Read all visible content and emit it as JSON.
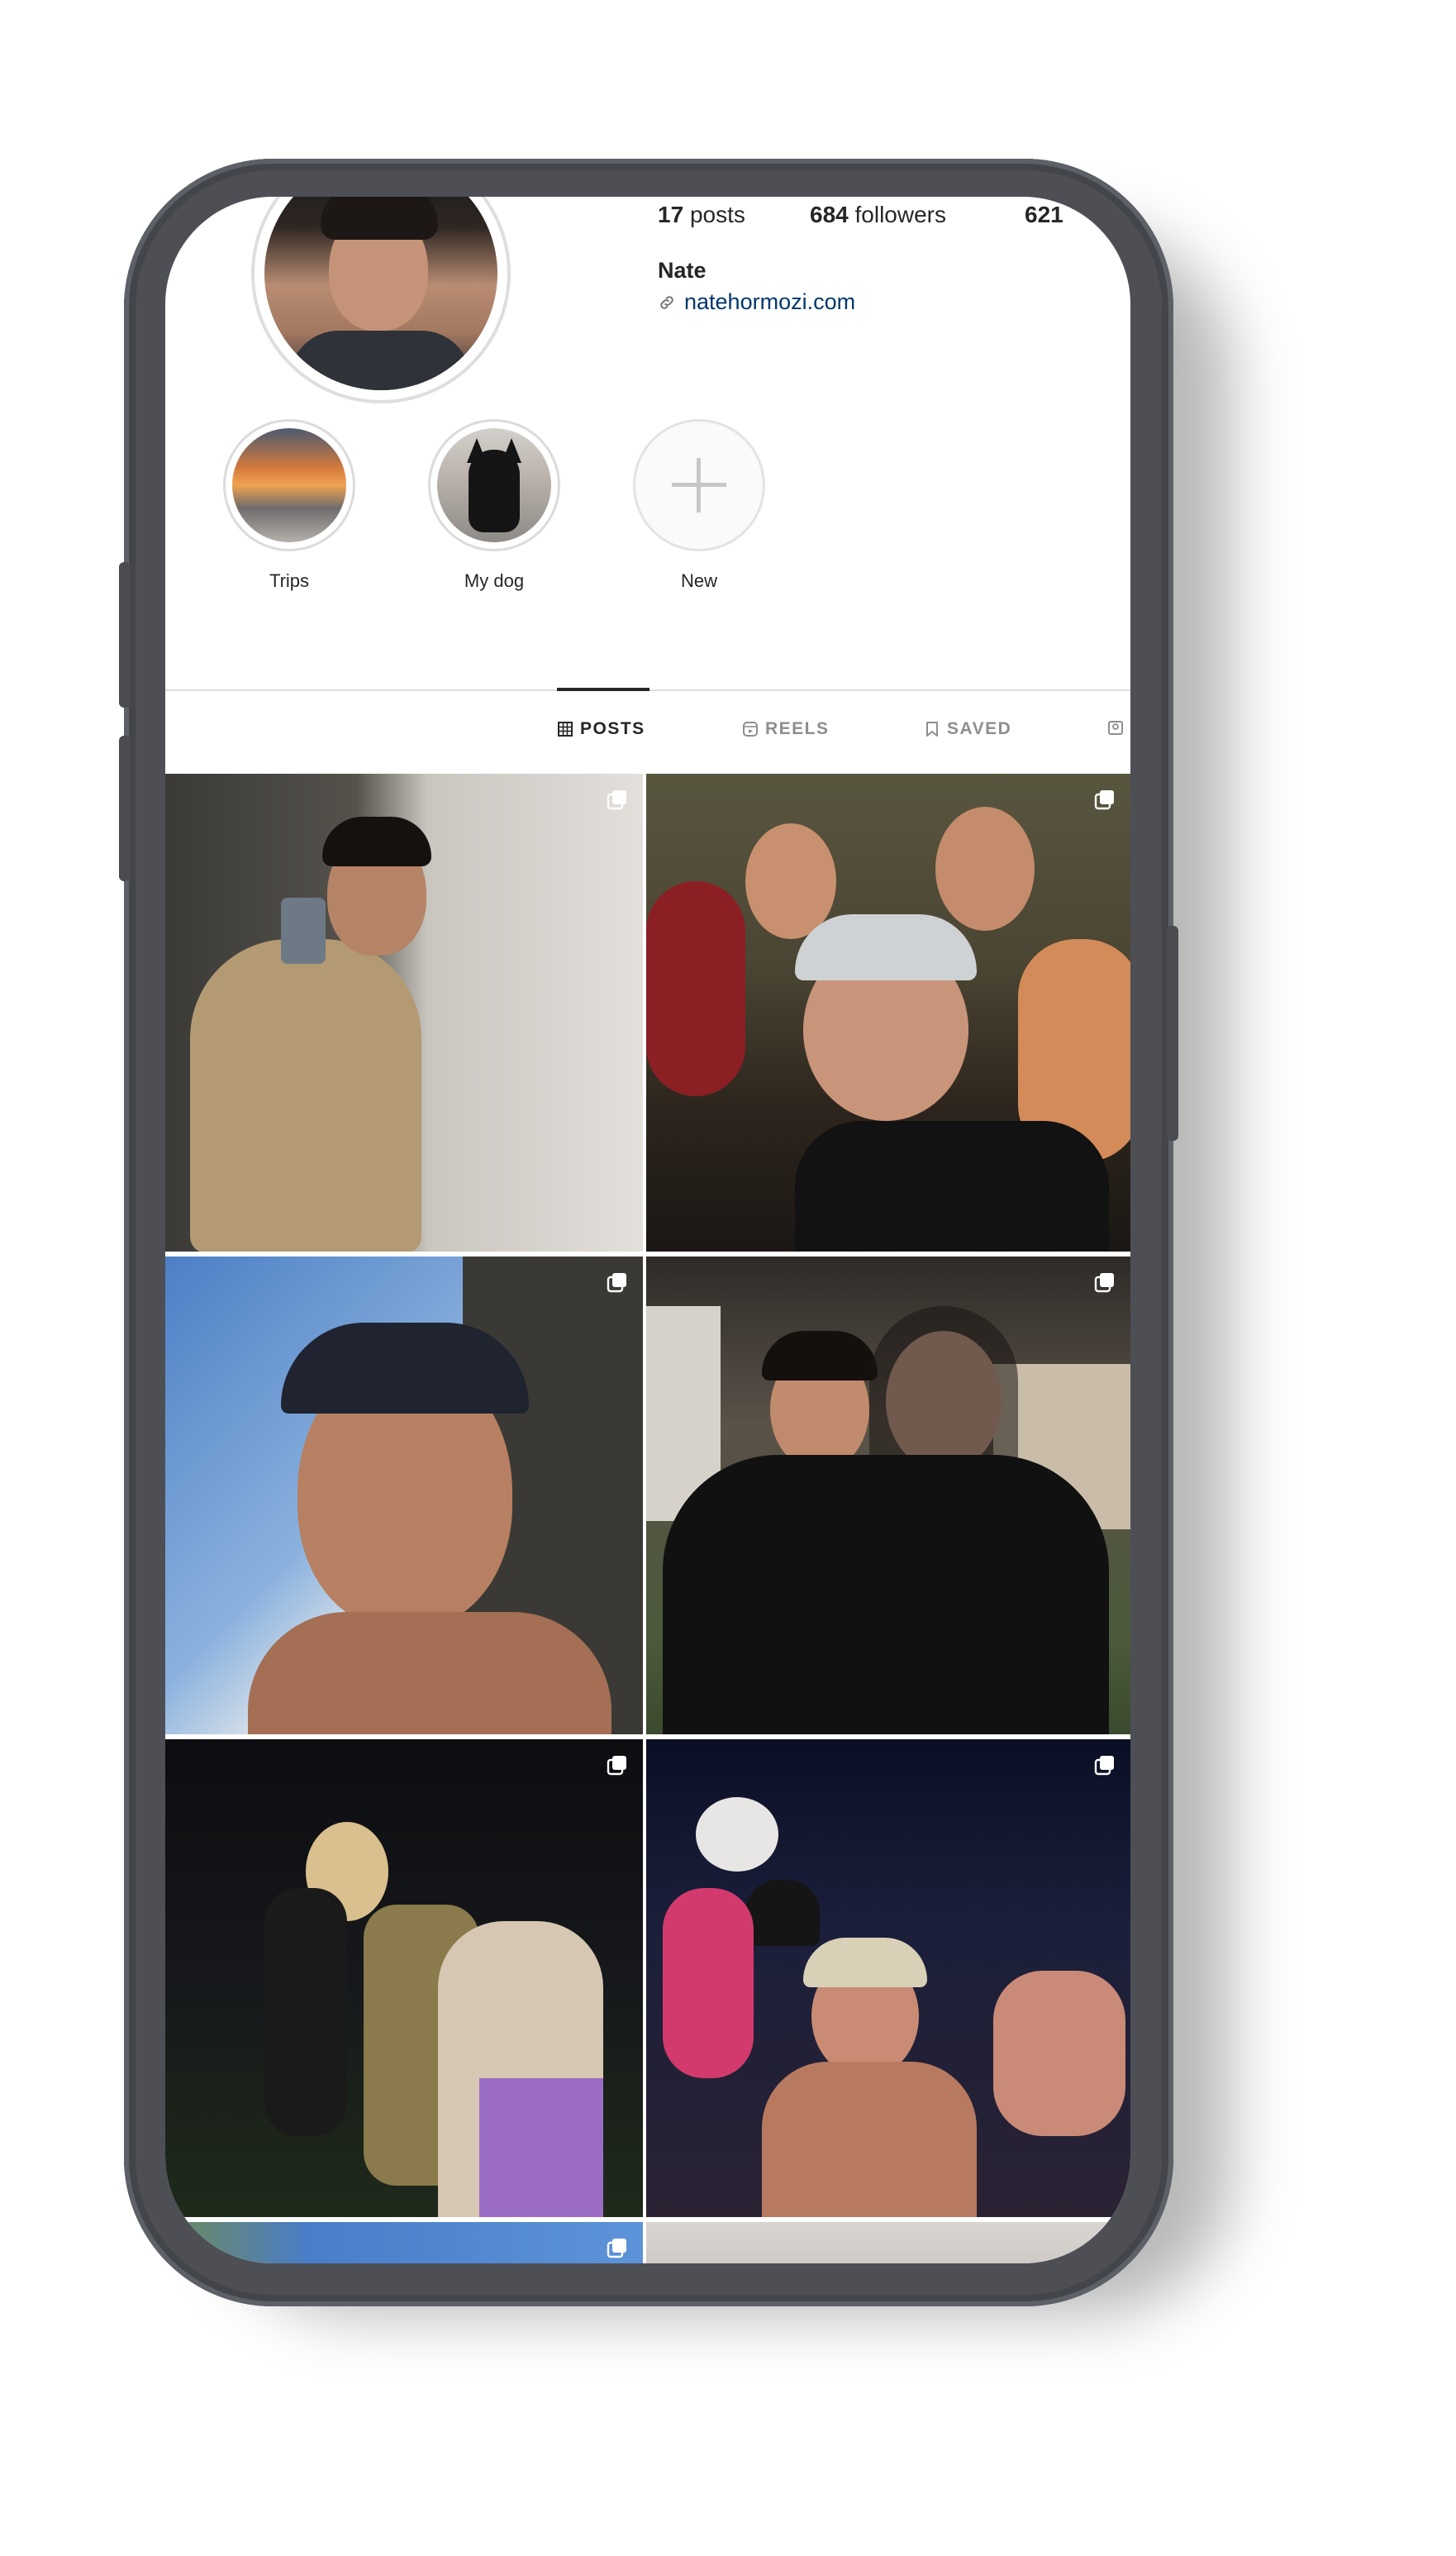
{
  "profile": {
    "stats": {
      "posts_count": "17",
      "posts_label": "posts",
      "followers_count": "684",
      "followers_label": "followers",
      "following_count": "621"
    },
    "name": "Nate",
    "link": "natehormozi.com"
  },
  "highlights": [
    {
      "label": "Trips",
      "icon": "trip-photo"
    },
    {
      "label": "My dog",
      "icon": "dog-photo"
    },
    {
      "label": "New",
      "icon": "plus-icon"
    }
  ],
  "tabs": [
    {
      "label": "POSTS",
      "icon": "grid-icon",
      "active": true
    },
    {
      "label": "REELS",
      "icon": "reels-icon",
      "active": false
    },
    {
      "label": "SAVED",
      "icon": "bookmark-icon",
      "active": false
    },
    {
      "label": "",
      "icon": "tagged-icon",
      "active": false
    }
  ],
  "posts": [
    {
      "description": "mirror selfie",
      "multi": true
    },
    {
      "description": "group selfie at restaurant",
      "multi": true
    },
    {
      "description": "car selfie with cap",
      "multi": true
    },
    {
      "description": "couple photo at night patio",
      "multi": true
    },
    {
      "description": "costume party outdoors",
      "multi": true
    },
    {
      "description": "crowded party",
      "multi": true
    },
    {
      "description": "sky photo",
      "multi": true
    },
    {
      "description": "indoor photo",
      "multi": false
    }
  ],
  "colors": {
    "text_primary": "#262626",
    "text_secondary": "#8e8e8e",
    "link": "#00376b",
    "divider": "#dbdbdb",
    "phone_frame": "#4d4f55"
  }
}
